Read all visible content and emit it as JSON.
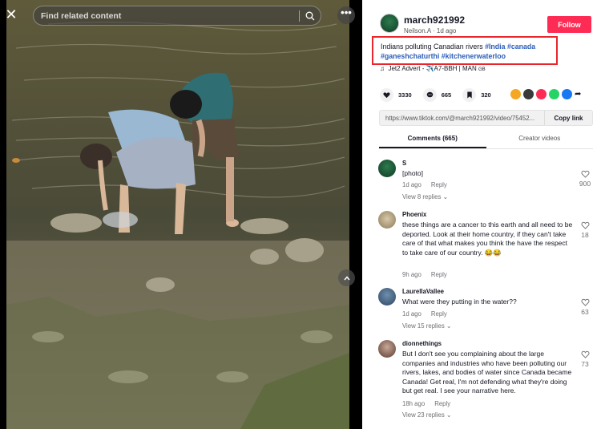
{
  "search": {
    "placeholder": "Find related content"
  },
  "post": {
    "username": "march921992",
    "subline": "Neilson.A · 1d ago",
    "follow_label": "Follow",
    "caption_text": "Indians polluting Canadian rivers ",
    "tags": [
      "#India",
      "#canada",
      "#ganeshchaturthi",
      "#kitchenerwaterloo"
    ],
    "music": "Jet2 Advert - ✈️A7-BBH | MAN ",
    "music_suffix": "GB",
    "likes": "3330",
    "comments": "665",
    "saves": "320",
    "share_colors": [
      "#f5a623",
      "#3a3a3a",
      "#fe2c55",
      "#25d366",
      "#1877f2"
    ],
    "url": "https://www.tiktok.com/@march921992/video/75452...",
    "copy_label": "Copy link"
  },
  "tabs": [
    {
      "label": "Comments (665)",
      "active": true
    },
    {
      "label": "Creator videos",
      "active": false
    }
  ],
  "comments": [
    {
      "user": "S",
      "text": "[photo]",
      "time": "1d ago",
      "reply": "Reply",
      "replies": "View 8 replies ⌄",
      "likes": "900",
      "avatar_color": "#1f5e3a"
    },
    {
      "user": "Phoenix",
      "text": "these things are a cancer to this earth and all need to be deported. Look at their home country, if they can't take care of that what makes you think the have the respect to take care of our country. 😂😂",
      "text2": "😂😂",
      "time": "9h ago",
      "reply": "Reply",
      "replies": "",
      "likes": "18",
      "avatar_color": "#b8a78a"
    },
    {
      "user": "LaurellaVallee",
      "text": "What were they putting in the water??",
      "time": "1d ago",
      "reply": "Reply",
      "replies": "View 15 replies ⌄",
      "likes": "63",
      "avatar_color": "#4b6f8c"
    },
    {
      "user": "dionnethings",
      "text": "But I don't see you complaining about the large companies and industries who have been polluting our rivers, lakes, and bodies of water since Canada became Canada! Get real, I'm not defending what they're doing but get real. I see your narrative here.",
      "time": "18h ago",
      "reply": "Reply",
      "replies": "View 23 replies ⌄",
      "likes": "73",
      "avatar_color": "#8a6a5a"
    }
  ]
}
